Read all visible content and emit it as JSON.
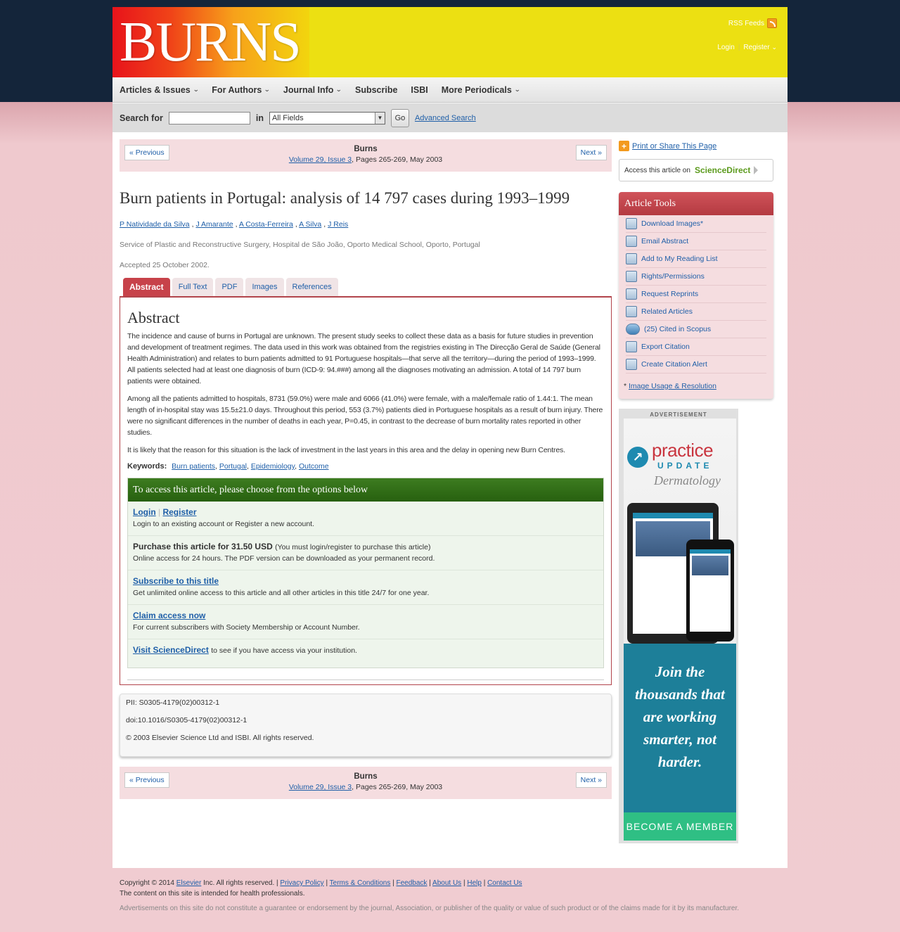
{
  "header": {
    "logo": "BURNS",
    "rss": "RSS Feeds",
    "login": "Login",
    "register": "Register"
  },
  "nav": {
    "items": [
      "Articles & Issues",
      "For Authors",
      "Journal Info",
      "Subscribe",
      "ISBI",
      "More Periodicals"
    ]
  },
  "search": {
    "label": "Search for",
    "in_label": "in",
    "field_value": "All Fields",
    "go": "Go",
    "advanced": "Advanced Search"
  },
  "pager": {
    "prev": "« Previous",
    "next": "Next »",
    "journal": "Burns",
    "volume": "Volume 29, Issue 3",
    "pages": ", Pages 265-269, May 2003"
  },
  "article": {
    "title": "Burn patients in Portugal: analysis of 14 797 cases during 1993–1999",
    "authors": [
      "P Natividade da Silva",
      "J Amarante",
      "A Costa-Ferreira",
      "A Silva",
      "J Reis"
    ],
    "affiliation": "Service of Plastic and Reconstructive Surgery, Hospital de São João, Oporto Medical School, Oporto, Portugal",
    "accepted": "Accepted 25 October 2002."
  },
  "tabs": [
    "Abstract",
    "Full Text",
    "PDF",
    "Images",
    "References"
  ],
  "abstract": {
    "heading": "Abstract",
    "p1": "The incidence and cause of burns in Portugal are unknown. The present study seeks to collect these data as a basis for future studies in prevention and development of treatment regimes. The data used in this work was obtained from the registries existing in The Direcção Geral de Saúde (General Health Administration) and relates to burn patients admitted to 91 Portuguese hospitals—that serve all the territory—during the period of 1993–1999. All patients selected had at least one diagnosis of burn (ICD-9: 94.###) among all the diagnoses motivating an admission. A total of 14 797 burn patients were obtained.",
    "p2": "Among all the patients admitted to hospitals, 8731 (59.0%) were male and 6066 (41.0%) were female, with a male/female ratio of 1.44:1. The mean length of in-hospital stay was 15.5±21.0 days. Throughout this period, 553 (3.7%) patients died in Portuguese hospitals as a result of burn injury. There were no significant differences in the number of deaths in each year, P=0.45, in contrast to the decrease of burn mortality rates reported in other studies.",
    "p3": "It is likely that the reason for this situation is the lack of investment in the last years in this area and the delay in opening new Burn Centres.",
    "keywords_label": "Keywords:",
    "keywords": [
      "Burn patients",
      "Portugal",
      "Epidemiology",
      "Outcome"
    ]
  },
  "access": {
    "heading": "To access this article, please choose from the options below",
    "login": "Login",
    "register": "Register",
    "login_desc": "Login to an existing account or Register a new account.",
    "purchase": "Purchase this article for 31.50 USD",
    "purchase_note": "(You must login/register to purchase this article)",
    "purchase_desc": "Online access for 24 hours. The PDF version can be downloaded as your permanent record.",
    "subscribe": "Subscribe to this title",
    "subscribe_desc": "Get unlimited online access to this article and all other articles in this title 24/7 for one year.",
    "claim": "Claim access now",
    "claim_desc": "For current subscribers with Society Membership or Account Number.",
    "sd": "Visit ScienceDirect",
    "sd_desc": "to see if you have access via your institution."
  },
  "meta": {
    "pii": "PII: S0305-4179(02)00312-1",
    "doi": "doi:10.1016/S0305-4179(02)00312-1",
    "copyright": "© 2003 Elsevier Science Ltd and ISBI. All rights reserved."
  },
  "sidebar": {
    "print": "Print or Share This Page",
    "access_on": "Access this article on",
    "sciencedirect": "ScienceDirect",
    "tools_title": "Article Tools",
    "tools": [
      {
        "label": "Download Images*",
        "icon": "image-download-icon"
      },
      {
        "label": "Email Abstract",
        "icon": "email-icon"
      },
      {
        "label": "Add to My Reading List",
        "icon": "reading-list-icon"
      },
      {
        "label": "Rights/Permissions",
        "icon": "lock-icon"
      },
      {
        "label": "Request Reprints",
        "icon": "reprint-icon"
      },
      {
        "label": "Related Articles",
        "icon": "related-articles-icon"
      },
      {
        "label": "(25) Cited in Scopus",
        "icon": "scopus-icon"
      },
      {
        "label": "Export Citation",
        "icon": "export-citation-icon"
      },
      {
        "label": "Create Citation Alert",
        "icon": "citation-alert-icon"
      }
    ],
    "note_star": "*",
    "note_link": "Image Usage & Resolution"
  },
  "ad": {
    "label": "ADVERTISEMENT",
    "brand": "practice",
    "brand2": "UPDATE",
    "specialty": "Dermatology",
    "slogan": "Join the thousands that are working smarter, not harder.",
    "cta": "BECOME A MEMBER"
  },
  "footer": {
    "copyright": "Copyright © 2014",
    "elsevier": "Elsevier",
    "rights": "Inc. All rights reserved. |",
    "links": [
      "Privacy Policy",
      "Terms & Conditions",
      "Feedback",
      "About Us",
      "Help",
      "Contact Us"
    ],
    "line2": "The content on this site is intended for health professionals.",
    "line3": "Advertisements on this site do not constitute a guarantee or endorsement by the journal, Association, or publisher of the quality or value of such product or of the claims made for it by its manufacturer."
  }
}
